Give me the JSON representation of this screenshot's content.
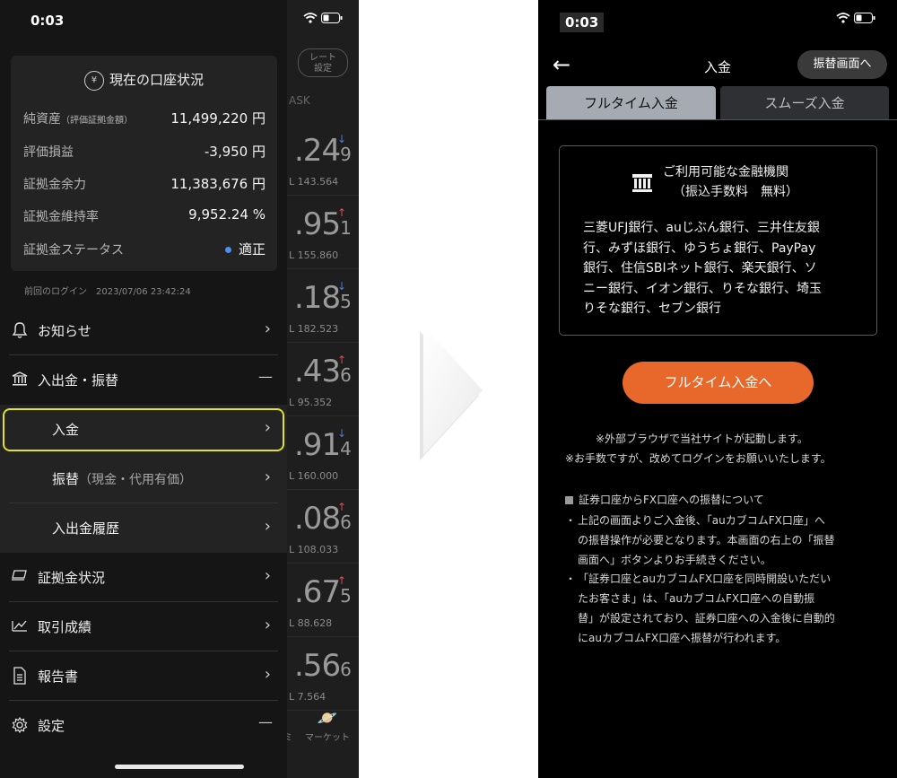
{
  "left_screen": {
    "status": {
      "time": "0:03"
    },
    "account": {
      "title": "現在の口座状況",
      "coin_icon_glyph": "¥",
      "rows": [
        {
          "label": "純資産",
          "sublabel": "（評価証拠金額）",
          "value": "11,499,220 円"
        },
        {
          "label": "評価損益",
          "value": "-3,950 円"
        },
        {
          "label": "証拠金余力",
          "value": "11,383,676 円"
        },
        {
          "label": "証拠金維持率",
          "value": "9,952.24 %"
        },
        {
          "label": "証拠金ステータス",
          "value": "適正",
          "status_color": "#4d8ff0"
        }
      ],
      "last_login": "前回のログイン　2023/07/06 23:42:24"
    },
    "menu": {
      "notices": "お知らせ",
      "deposit_transfer": "入出金・振替",
      "deposit": "入金",
      "transfer": "振替",
      "transfer_note": "（現金・代用有価）",
      "history": "入出金履歴",
      "margin_status": "証拠金状況",
      "trade_results": "取引成績",
      "reports": "報告書",
      "settings": "設定",
      "highlight_color": "#e3e322"
    },
    "background": {
      "rate_button": "レート\n設定",
      "ask_header": "ASK",
      "quotes": [
        {
          "big": ".24",
          "small": "9",
          "low": "L 143.564",
          "direction": "down"
        },
        {
          "big": ".95",
          "small": "1",
          "low": "L 155.860",
          "direction": "up"
        },
        {
          "big": ".18",
          "small": "5",
          "low": "L 182.523",
          "direction": "down"
        },
        {
          "big": ".43",
          "small": "6",
          "low": "L 95.352",
          "direction": "up"
        },
        {
          "big": ".91",
          "small": "4",
          "low": "L 160.000",
          "direction": "down"
        },
        {
          "big": ".08",
          "small": "6",
          "low": "L 108.033",
          "direction": "up"
        },
        {
          "big": ".67",
          "small": "5",
          "low": "L 88.628",
          "direction": "up"
        },
        {
          "big": ".56",
          "small": "6",
          "low": "L 7.564",
          "direction": "none"
        }
      ],
      "market_label": "マーケット",
      "market_prefix": "ミ"
    }
  },
  "right_screen": {
    "status": {
      "time": "0:03"
    },
    "nav": {
      "back": "←",
      "title": "入金",
      "transfer_button": "振替画面へ"
    },
    "tabs": [
      {
        "label": "フルタイム入金",
        "active": true
      },
      {
        "label": "スムーズ入金",
        "active": false
      }
    ],
    "banks": {
      "title": "ご利用可能な金融機関",
      "fee": "（振込手数料　無料）",
      "list_lines": [
        "三菱UFJ銀行、auじぶん銀行、三井住友銀",
        "行、みずほ銀行、ゆうちょ銀行、PayPay",
        "銀行、住信SBIネット銀行、楽天銀行、ソ",
        "ニー銀行、イオン銀行、りそな銀行、埼玉",
        "りそな銀行、セブン銀行"
      ]
    },
    "cta": {
      "label": "フルタイム入金へ",
      "color": "#e7682a"
    },
    "notes": [
      "※外部ブラウザで当社サイトが起動します。",
      "※お手数ですが、改めてログインをお願いいたします。"
    ],
    "info": {
      "heading": "証券口座からFX口座への振替について",
      "bullets": [
        {
          "bullet": "・",
          "lines": [
            "上記の画面よりご入金後、「auカブコムFX口座」へ",
            "の振替操作が必要となります。本画面の右上の「振替",
            "画面へ」ボタンよりお手続きください。"
          ]
        },
        {
          "bullet": "・",
          "lines": [
            "「証券口座とauカブコムFX口座を同時開設いただい",
            "たお客さま」は、「auカブコムFX口座への自動振",
            "替」が設定されており、証券口座への入金後に自動的",
            "にauカブコムFX口座へ振替が行われます。"
          ]
        }
      ]
    }
  }
}
